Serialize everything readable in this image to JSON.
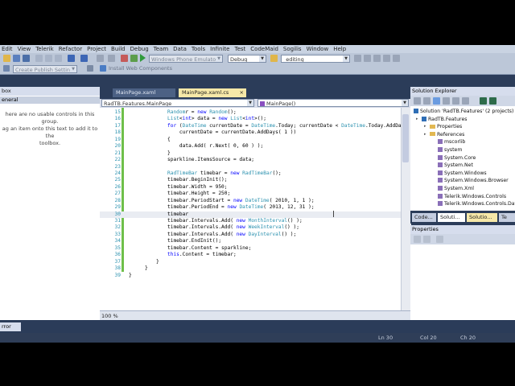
{
  "menu": [
    "Edit",
    "View",
    "Telerik",
    "Refactor",
    "Project",
    "Build",
    "Debug",
    "Team",
    "Data",
    "Tools",
    "Infinite",
    "Test",
    "CodeMaid",
    "Sogilis",
    "Window",
    "Help"
  ],
  "toolbar": {
    "device_combo": "Windows Phone Emulator",
    "config_combo": "Debug",
    "find_combo": "_editing",
    "publish_combo": "Create Publish Settings",
    "install_label": "Install Web Components"
  },
  "toolbox": {
    "title": "box",
    "group": "eneral",
    "message_lines": [
      "here are no usable controls in this group.",
      "ag an item onto this text to add it to the",
      "toolbox."
    ]
  },
  "tabs": {
    "doc_tab_1": "MainPage.xaml",
    "doc_tab_2": "MainPage.xaml.cs",
    "close_glyph": "×"
  },
  "nav": {
    "class_combo": "RadTB.Features.MainPage",
    "member_combo": "MainPage()"
  },
  "code": {
    "lines": [
      {
        "n": "15",
        "t": [
          [
            "ty",
            "Random"
          ],
          [
            "",
            "r = "
          ],
          [
            "kw",
            "new"
          ],
          [
            "",
            " "
          ],
          [
            "ty",
            "Random"
          ],
          [
            "",
            "();"
          ]
        ]
      },
      {
        "n": "16",
        "t": [
          [
            "ty",
            "List"
          ],
          [
            "",
            "<"
          ],
          [
            "kw",
            "int"
          ],
          [
            "",
            "> data = "
          ],
          [
            "kw",
            "new"
          ],
          [
            "",
            " "
          ],
          [
            "ty",
            "List"
          ],
          [
            "",
            "<"
          ],
          [
            "kw",
            "int"
          ],
          [
            "",
            ">();"
          ]
        ]
      },
      {
        "n": "17",
        "t": [
          [
            "kw",
            "for"
          ],
          [
            "",
            " ("
          ],
          [
            "ty",
            "DateTime"
          ],
          [
            "",
            " currentDate = "
          ],
          [
            "ty",
            "DateTime"
          ],
          [
            "",
            ".Today; currentDate < "
          ],
          [
            "ty",
            "DateTime"
          ],
          [
            "",
            ".Today.AddDay"
          ]
        ]
      },
      {
        "n": "18",
        "t": [
          [
            "",
            "    currentDate = currentDate.AddDays( 1 ))"
          ]
        ]
      },
      {
        "n": "19",
        "t": [
          [
            "",
            "{"
          ]
        ]
      },
      {
        "n": "20",
        "t": [
          [
            "",
            "    data.Add( r.Next( 0, 60 ) );"
          ]
        ]
      },
      {
        "n": "21",
        "t": [
          [
            "",
            "}"
          ]
        ]
      },
      {
        "n": "22",
        "t": [
          [
            "",
            "sparkline.ItemsSource = data;"
          ]
        ]
      },
      {
        "n": "23",
        "t": [
          [
            "",
            ""
          ]
        ]
      },
      {
        "n": "24",
        "t": [
          [
            "ty",
            "RadTimeBar"
          ],
          [
            "",
            " timebar = "
          ],
          [
            "kw",
            "new"
          ],
          [
            "",
            " "
          ],
          [
            "ty",
            "RadTimeBar"
          ],
          [
            "",
            "();"
          ]
        ]
      },
      {
        "n": "25",
        "t": [
          [
            "",
            "timebar.BeginInit();"
          ]
        ]
      },
      {
        "n": "26",
        "t": [
          [
            "",
            "timebar.Width = 950;"
          ]
        ]
      },
      {
        "n": "27",
        "t": [
          [
            "",
            "timebar.Height = 250;"
          ]
        ]
      },
      {
        "n": "28",
        "t": [
          [
            "",
            "timebar.PeriodStart = "
          ],
          [
            "kw",
            "new"
          ],
          [
            "",
            " "
          ],
          [
            "ty",
            "DateTime"
          ],
          [
            "",
            "( 2010, 1, 1 );"
          ]
        ]
      },
      {
        "n": "29",
        "t": [
          [
            "",
            "timebar.PeriodEnd = "
          ],
          [
            "kw",
            "new"
          ],
          [
            "",
            " "
          ],
          [
            "ty",
            "DateTime"
          ],
          [
            "",
            "( 2013, 12, 31 );"
          ]
        ]
      },
      {
        "n": "30",
        "t": [
          [
            "",
            "timebar"
          ]
        ]
      },
      {
        "n": "31",
        "t": [
          [
            "",
            "timebar.Intervals.Add( "
          ],
          [
            "kw",
            "new"
          ],
          [
            "",
            " "
          ],
          [
            "ty",
            "MonthInterval"
          ],
          [
            "",
            "() );"
          ]
        ]
      },
      {
        "n": "32",
        "t": [
          [
            "",
            "timebar.Intervals.Add( "
          ],
          [
            "kw",
            "new"
          ],
          [
            "",
            " "
          ],
          [
            "ty",
            "WeekInterval"
          ],
          [
            "",
            "() );"
          ]
        ]
      },
      {
        "n": "33",
        "t": [
          [
            "",
            "timebar.Intervals.Add( "
          ],
          [
            "kw",
            "new"
          ],
          [
            "",
            " "
          ],
          [
            "ty",
            "DayInterval"
          ],
          [
            "",
            "() );"
          ]
        ]
      },
      {
        "n": "34",
        "t": [
          [
            "",
            "timebar.EndInit();"
          ]
        ]
      },
      {
        "n": "35",
        "t": [
          [
            "",
            "timebar.Content = sparkline;"
          ]
        ]
      },
      {
        "n": "36",
        "t": [
          [
            "kw",
            "this"
          ],
          [
            "",
            ".Content = timebar;"
          ]
        ]
      },
      {
        "n": "37",
        "t": [
          [
            "",
            "}"
          ]
        ]
      },
      {
        "n": "38",
        "t": [
          [
            "",
            "}"
          ]
        ]
      },
      {
        "n": "39",
        "t": [
          [
            "",
            "}"
          ]
        ]
      }
    ]
  },
  "editor": {
    "zoom": "100 %"
  },
  "solution_explorer": {
    "title": "Solution Explorer",
    "items": [
      {
        "label": "Solution 'RadTB.Features' (2 projects)",
        "indent": 0,
        "icon": "solution"
      },
      {
        "label": "RadTB.Features",
        "indent": 1,
        "icon": "project"
      },
      {
        "label": "Properties",
        "indent": 2,
        "icon": "folder"
      },
      {
        "label": "References",
        "indent": 2,
        "icon": "folder"
      },
      {
        "label": "mscorlib",
        "indent": 3,
        "icon": "ref"
      },
      {
        "label": "system",
        "indent": 3,
        "icon": "ref"
      },
      {
        "label": "System.Core",
        "indent": 3,
        "icon": "ref"
      },
      {
        "label": "System.Net",
        "indent": 3,
        "icon": "ref"
      },
      {
        "label": "System.Windows",
        "indent": 3,
        "icon": "ref"
      },
      {
        "label": "System.Windows.Browser",
        "indent": 3,
        "icon": "ref"
      },
      {
        "label": "System.Xml",
        "indent": 3,
        "icon": "ref"
      },
      {
        "label": "Telerik.Windows.Controls",
        "indent": 3,
        "icon": "ref"
      },
      {
        "label": "Telerik.Windows.Controls.Data",
        "indent": 3,
        "icon": "ref"
      }
    ],
    "tabs": [
      "Code...",
      "Soluti...",
      "Solutio...",
      "Te"
    ]
  },
  "properties": {
    "title": "Properties"
  },
  "bottom": {
    "error_list_tab": "rror List",
    "status_ln": "Ln 30",
    "status_col": "Col 20",
    "status_ch": "Ch 20"
  }
}
